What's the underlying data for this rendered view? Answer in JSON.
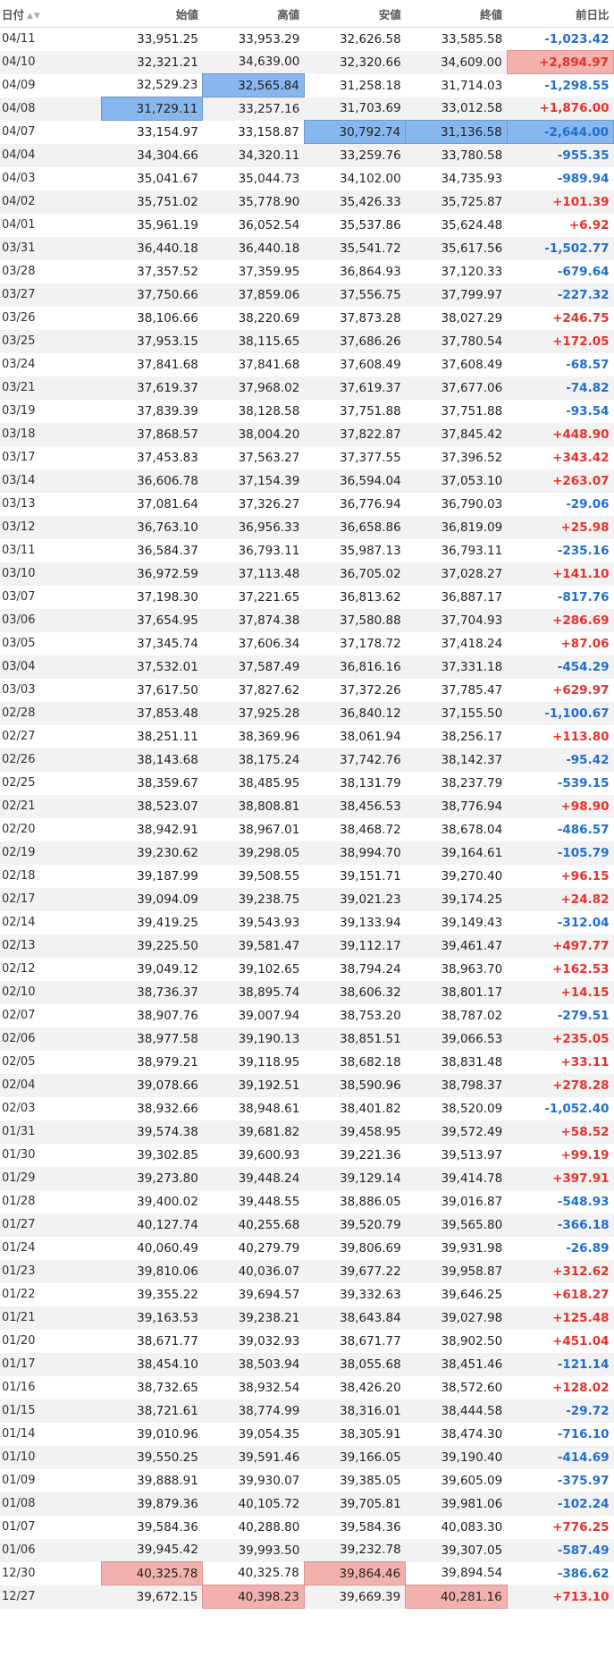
{
  "header": {
    "date": "日付",
    "open": "始値",
    "high": "高値",
    "low": "安値",
    "close": "終値",
    "change": "前日比"
  },
  "colors": {
    "positive": "#e8302a",
    "negative": "#1e6fcf",
    "highlight_low": "#87b7ee",
    "highlight_high": "#f3b1ae"
  },
  "rows": [
    {
      "date": "04/11",
      "open": "33,951.25",
      "high": "33,953.29",
      "low": "32,626.58",
      "close": "33,585.58",
      "change": "-1,023.42"
    },
    {
      "date": "04/10",
      "open": "32,321.21",
      "high": "34,639.00",
      "low": "32,320.66",
      "close": "34,609.00",
      "change": "+2,894.97"
    },
    {
      "date": "04/09",
      "open": "32,529.23",
      "high": "32,565.84",
      "low": "31,258.18",
      "close": "31,714.03",
      "change": "-1,298.55"
    },
    {
      "date": "04/08",
      "open": "31,729.11",
      "high": "33,257.16",
      "low": "31,703.69",
      "close": "33,012.58",
      "change": "+1,876.00"
    },
    {
      "date": "04/07",
      "open": "33,154.97",
      "high": "33,158.87",
      "low": "30,792.74",
      "close": "31,136.58",
      "change": "-2,644.00"
    },
    {
      "date": "04/04",
      "open": "34,304.66",
      "high": "34,320.11",
      "low": "33,259.76",
      "close": "33,780.58",
      "change": "-955.35"
    },
    {
      "date": "04/03",
      "open": "35,041.67",
      "high": "35,044.73",
      "low": "34,102.00",
      "close": "34,735.93",
      "change": "-989.94"
    },
    {
      "date": "04/02",
      "open": "35,751.02",
      "high": "35,778.90",
      "low": "35,426.33",
      "close": "35,725.87",
      "change": "+101.39"
    },
    {
      "date": "04/01",
      "open": "35,961.19",
      "high": "36,052.54",
      "low": "35,537.86",
      "close": "35,624.48",
      "change": "+6.92"
    },
    {
      "date": "03/31",
      "open": "36,440.18",
      "high": "36,440.18",
      "low": "35,541.72",
      "close": "35,617.56",
      "change": "-1,502.77"
    },
    {
      "date": "03/28",
      "open": "37,357.52",
      "high": "37,359.95",
      "low": "36,864.93",
      "close": "37,120.33",
      "change": "-679.64"
    },
    {
      "date": "03/27",
      "open": "37,750.66",
      "high": "37,859.06",
      "low": "37,556.75",
      "close": "37,799.97",
      "change": "-227.32"
    },
    {
      "date": "03/26",
      "open": "38,106.66",
      "high": "38,220.69",
      "low": "37,873.28",
      "close": "38,027.29",
      "change": "+246.75"
    },
    {
      "date": "03/25",
      "open": "37,953.15",
      "high": "38,115.65",
      "low": "37,686.26",
      "close": "37,780.54",
      "change": "+172.05"
    },
    {
      "date": "03/24",
      "open": "37,841.68",
      "high": "37,841.68",
      "low": "37,608.49",
      "close": "37,608.49",
      "change": "-68.57"
    },
    {
      "date": "03/21",
      "open": "37,619.37",
      "high": "37,968.02",
      "low": "37,619.37",
      "close": "37,677.06",
      "change": "-74.82"
    },
    {
      "date": "03/19",
      "open": "37,839.39",
      "high": "38,128.58",
      "low": "37,751.88",
      "close": "37,751.88",
      "change": "-93.54"
    },
    {
      "date": "03/18",
      "open": "37,868.57",
      "high": "38,004.20",
      "low": "37,822.87",
      "close": "37,845.42",
      "change": "+448.90"
    },
    {
      "date": "03/17",
      "open": "37,453.83",
      "high": "37,563.27",
      "low": "37,377.55",
      "close": "37,396.52",
      "change": "+343.42"
    },
    {
      "date": "03/14",
      "open": "36,606.78",
      "high": "37,154.39",
      "low": "36,594.04",
      "close": "37,053.10",
      "change": "+263.07"
    },
    {
      "date": "03/13",
      "open": "37,081.64",
      "high": "37,326.27",
      "low": "36,776.94",
      "close": "36,790.03",
      "change": "-29.06"
    },
    {
      "date": "03/12",
      "open": "36,763.10",
      "high": "36,956.33",
      "low": "36,658.86",
      "close": "36,819.09",
      "change": "+25.98"
    },
    {
      "date": "03/11",
      "open": "36,584.37",
      "high": "36,793.11",
      "low": "35,987.13",
      "close": "36,793.11",
      "change": "-235.16"
    },
    {
      "date": "03/10",
      "open": "36,972.59",
      "high": "37,113.48",
      "low": "36,705.02",
      "close": "37,028.27",
      "change": "+141.10"
    },
    {
      "date": "03/07",
      "open": "37,198.30",
      "high": "37,221.65",
      "low": "36,813.62",
      "close": "36,887.17",
      "change": "-817.76"
    },
    {
      "date": "03/06",
      "open": "37,654.95",
      "high": "37,874.38",
      "low": "37,580.88",
      "close": "37,704.93",
      "change": "+286.69"
    },
    {
      "date": "03/05",
      "open": "37,345.74",
      "high": "37,606.34",
      "low": "37,178.72",
      "close": "37,418.24",
      "change": "+87.06"
    },
    {
      "date": "03/04",
      "open": "37,532.01",
      "high": "37,587.49",
      "low": "36,816.16",
      "close": "37,331.18",
      "change": "-454.29"
    },
    {
      "date": "03/03",
      "open": "37,617.50",
      "high": "37,827.62",
      "low": "37,372.26",
      "close": "37,785.47",
      "change": "+629.97"
    },
    {
      "date": "02/28",
      "open": "37,853.48",
      "high": "37,925.28",
      "low": "36,840.12",
      "close": "37,155.50",
      "change": "-1,100.67"
    },
    {
      "date": "02/27",
      "open": "38,251.11",
      "high": "38,369.96",
      "low": "38,061.94",
      "close": "38,256.17",
      "change": "+113.80"
    },
    {
      "date": "02/26",
      "open": "38,143.68",
      "high": "38,175.24",
      "low": "37,742.76",
      "close": "38,142.37",
      "change": "-95.42"
    },
    {
      "date": "02/25",
      "open": "38,359.67",
      "high": "38,485.95",
      "low": "38,131.79",
      "close": "38,237.79",
      "change": "-539.15"
    },
    {
      "date": "02/21",
      "open": "38,523.07",
      "high": "38,808.81",
      "low": "38,456.53",
      "close": "38,776.94",
      "change": "+98.90"
    },
    {
      "date": "02/20",
      "open": "38,942.91",
      "high": "38,967.01",
      "low": "38,468.72",
      "close": "38,678.04",
      "change": "-486.57"
    },
    {
      "date": "02/19",
      "open": "39,230.62",
      "high": "39,298.05",
      "low": "38,994.70",
      "close": "39,164.61",
      "change": "-105.79"
    },
    {
      "date": "02/18",
      "open": "39,187.99",
      "high": "39,508.55",
      "low": "39,151.71",
      "close": "39,270.40",
      "change": "+96.15"
    },
    {
      "date": "02/17",
      "open": "39,094.09",
      "high": "39,238.75",
      "low": "39,021.23",
      "close": "39,174.25",
      "change": "+24.82"
    },
    {
      "date": "02/14",
      "open": "39,419.25",
      "high": "39,543.93",
      "low": "39,133.94",
      "close": "39,149.43",
      "change": "-312.04"
    },
    {
      "date": "02/13",
      "open": "39,225.50",
      "high": "39,581.47",
      "low": "39,112.17",
      "close": "39,461.47",
      "change": "+497.77"
    },
    {
      "date": "02/12",
      "open": "39,049.12",
      "high": "39,102.65",
      "low": "38,794.24",
      "close": "38,963.70",
      "change": "+162.53"
    },
    {
      "date": "02/10",
      "open": "38,736.37",
      "high": "38,895.74",
      "low": "38,606.32",
      "close": "38,801.17",
      "change": "+14.15"
    },
    {
      "date": "02/07",
      "open": "38,907.76",
      "high": "39,007.94",
      "low": "38,753.20",
      "close": "38,787.02",
      "change": "-279.51"
    },
    {
      "date": "02/06",
      "open": "38,977.58",
      "high": "39,190.13",
      "low": "38,851.51",
      "close": "39,066.53",
      "change": "+235.05"
    },
    {
      "date": "02/05",
      "open": "38,979.21",
      "high": "39,118.95",
      "low": "38,682.18",
      "close": "38,831.48",
      "change": "+33.11"
    },
    {
      "date": "02/04",
      "open": "39,078.66",
      "high": "39,192.51",
      "low": "38,590.96",
      "close": "38,798.37",
      "change": "+278.28"
    },
    {
      "date": "02/03",
      "open": "38,932.66",
      "high": "38,948.61",
      "low": "38,401.82",
      "close": "38,520.09",
      "change": "-1,052.40"
    },
    {
      "date": "01/31",
      "open": "39,574.38",
      "high": "39,681.82",
      "low": "39,458.95",
      "close": "39,572.49",
      "change": "+58.52"
    },
    {
      "date": "01/30",
      "open": "39,302.85",
      "high": "39,600.93",
      "low": "39,221.36",
      "close": "39,513.97",
      "change": "+99.19"
    },
    {
      "date": "01/29",
      "open": "39,273.80",
      "high": "39,448.24",
      "low": "39,129.14",
      "close": "39,414.78",
      "change": "+397.91"
    },
    {
      "date": "01/28",
      "open": "39,400.02",
      "high": "39,448.55",
      "low": "38,886.05",
      "close": "39,016.87",
      "change": "-548.93"
    },
    {
      "date": "01/27",
      "open": "40,127.74",
      "high": "40,255.68",
      "low": "39,520.79",
      "close": "39,565.80",
      "change": "-366.18"
    },
    {
      "date": "01/24",
      "open": "40,060.49",
      "high": "40,279.79",
      "low": "39,806.69",
      "close": "39,931.98",
      "change": "-26.89"
    },
    {
      "date": "01/23",
      "open": "39,810.06",
      "high": "40,036.07",
      "low": "39,677.22",
      "close": "39,958.87",
      "change": "+312.62"
    },
    {
      "date": "01/22",
      "open": "39,355.22",
      "high": "39,694.57",
      "low": "39,332.63",
      "close": "39,646.25",
      "change": "+618.27"
    },
    {
      "date": "01/21",
      "open": "39,163.53",
      "high": "39,238.21",
      "low": "38,643.84",
      "close": "39,027.98",
      "change": "+125.48"
    },
    {
      "date": "01/20",
      "open": "38,671.77",
      "high": "39,032.93",
      "low": "38,671.77",
      "close": "38,902.50",
      "change": "+451.04"
    },
    {
      "date": "01/17",
      "open": "38,454.10",
      "high": "38,503.94",
      "low": "38,055.68",
      "close": "38,451.46",
      "change": "-121.14"
    },
    {
      "date": "01/16",
      "open": "38,732.65",
      "high": "38,932.54",
      "low": "38,426.20",
      "close": "38,572.60",
      "change": "+128.02"
    },
    {
      "date": "01/15",
      "open": "38,721.61",
      "high": "38,774.99",
      "low": "38,316.01",
      "close": "38,444.58",
      "change": "-29.72"
    },
    {
      "date": "01/14",
      "open": "39,010.96",
      "high": "39,054.35",
      "low": "38,305.91",
      "close": "38,474.30",
      "change": "-716.10"
    },
    {
      "date": "01/10",
      "open": "39,550.25",
      "high": "39,591.46",
      "low": "39,166.05",
      "close": "39,190.40",
      "change": "-414.69"
    },
    {
      "date": "01/09",
      "open": "39,888.91",
      "high": "39,930.07",
      "low": "39,385.05",
      "close": "39,605.09",
      "change": "-375.97"
    },
    {
      "date": "01/08",
      "open": "39,879.36",
      "high": "40,105.72",
      "low": "39,705.81",
      "close": "39,981.06",
      "change": "-102.24"
    },
    {
      "date": "01/07",
      "open": "39,584.36",
      "high": "40,288.80",
      "low": "39,584.36",
      "close": "40,083.30",
      "change": "+776.25"
    },
    {
      "date": "01/06",
      "open": "39,945.42",
      "high": "39,993.50",
      "low": "39,232.78",
      "close": "39,307.05",
      "change": "-587.49"
    },
    {
      "date": "12/30",
      "open": "40,325.78",
      "high": "40,325.78",
      "low": "39,864.46",
      "close": "39,894.54",
      "change": "-386.62"
    },
    {
      "date": "12/27",
      "open": "39,672.15",
      "high": "40,398.23",
      "low": "39,669.39",
      "close": "40,281.16",
      "change": "+713.10"
    }
  ]
}
